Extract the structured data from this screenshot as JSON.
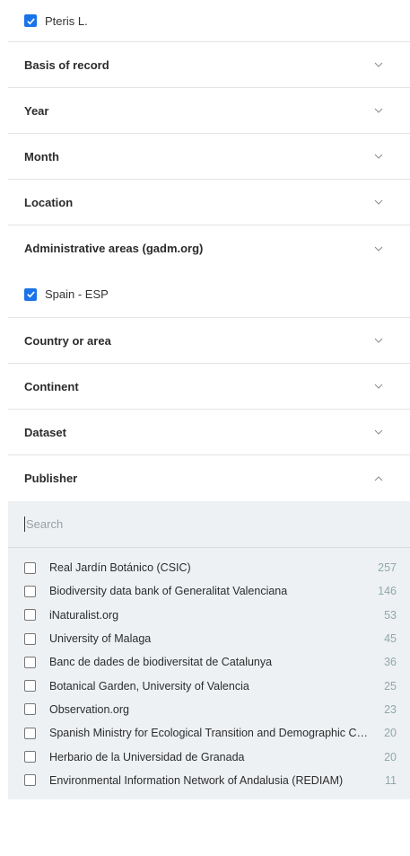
{
  "selected_top": {
    "label": "Pteris L."
  },
  "facets": {
    "basis": "Basis of record",
    "year": "Year",
    "month": "Month",
    "location": "Location",
    "admin": "Administrative areas (gadm.org)",
    "admin_selected": "Spain - ESP",
    "country": "Country or area",
    "continent": "Continent",
    "dataset": "Dataset",
    "publisher": "Publisher"
  },
  "publisher": {
    "search_placeholder": "Search",
    "options": [
      {
        "label": "Real Jardín Botánico (CSIC)",
        "count": "257"
      },
      {
        "label": "Biodiversity data bank of Generalitat Valenciana",
        "count": "146"
      },
      {
        "label": "iNaturalist.org",
        "count": "53"
      },
      {
        "label": "University of Malaga",
        "count": "45"
      },
      {
        "label": "Banc de dades de biodiversitat de Catalunya",
        "count": "36"
      },
      {
        "label": "Botanical Garden, University of Valencia",
        "count": "25"
      },
      {
        "label": "Observation.org",
        "count": "23"
      },
      {
        "label": "Spanish Ministry for Ecological Transition and Demographic Challenge",
        "count": "20"
      },
      {
        "label": "Herbario de la Universidad de Granada",
        "count": "20"
      },
      {
        "label": "Environmental Information Network of Andalusia (REDIAM)",
        "count": "11"
      }
    ]
  },
  "colors": {
    "accent": "#1a73e8",
    "count": "#8fa8a8",
    "list_bg": "#eef1f4"
  }
}
